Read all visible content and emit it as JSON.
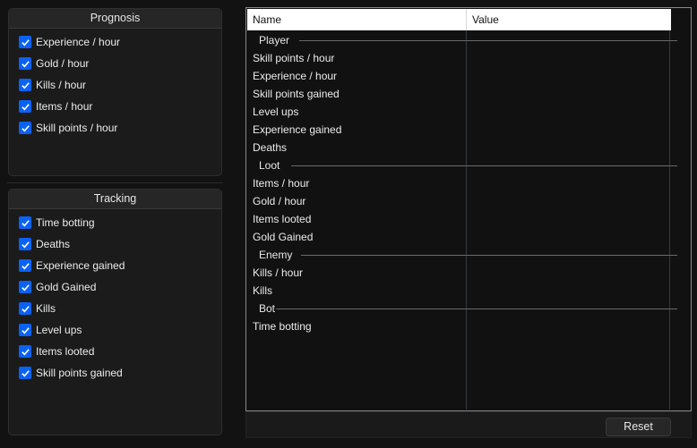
{
  "prognosis": {
    "title": "Prognosis",
    "items": [
      {
        "label": "Experience / hour",
        "checked": true
      },
      {
        "label": "Gold / hour",
        "checked": true
      },
      {
        "label": "Kills / hour",
        "checked": true
      },
      {
        "label": "Items / hour",
        "checked": true
      },
      {
        "label": "Skill points / hour",
        "checked": true
      }
    ]
  },
  "tracking": {
    "title": "Tracking",
    "items": [
      {
        "label": "Time botting",
        "checked": true
      },
      {
        "label": "Deaths",
        "checked": true
      },
      {
        "label": "Experience gained",
        "checked": true
      },
      {
        "label": "Gold Gained",
        "checked": true
      },
      {
        "label": "Kills",
        "checked": true
      },
      {
        "label": "Level ups",
        "checked": true
      },
      {
        "label": "Items looted",
        "checked": true
      },
      {
        "label": "Skill points gained",
        "checked": true
      }
    ]
  },
  "table": {
    "columns": [
      "Name",
      "Value"
    ],
    "sections": [
      {
        "title": "Player",
        "rows": [
          {
            "name": "Skill points / hour",
            "value": ""
          },
          {
            "name": "Experience / hour",
            "value": ""
          },
          {
            "name": "Skill points gained",
            "value": ""
          },
          {
            "name": "Level ups",
            "value": ""
          },
          {
            "name": "Experience gained",
            "value": ""
          },
          {
            "name": "Deaths",
            "value": ""
          }
        ]
      },
      {
        "title": "Loot",
        "rows": [
          {
            "name": "Items / hour",
            "value": ""
          },
          {
            "name": "Gold / hour",
            "value": ""
          },
          {
            "name": "Items looted",
            "value": ""
          },
          {
            "name": "Gold Gained",
            "value": ""
          }
        ]
      },
      {
        "title": "Enemy",
        "rows": [
          {
            "name": "Kills / hour",
            "value": ""
          },
          {
            "name": "Kills",
            "value": ""
          }
        ]
      },
      {
        "title": "Bot",
        "rows": [
          {
            "name": "Time botting",
            "value": ""
          }
        ]
      }
    ]
  },
  "footer": {
    "reset_label": "Reset"
  },
  "colors": {
    "accent": "#0a62f5",
    "background": "#121212",
    "panel": "#1b1b1b"
  }
}
